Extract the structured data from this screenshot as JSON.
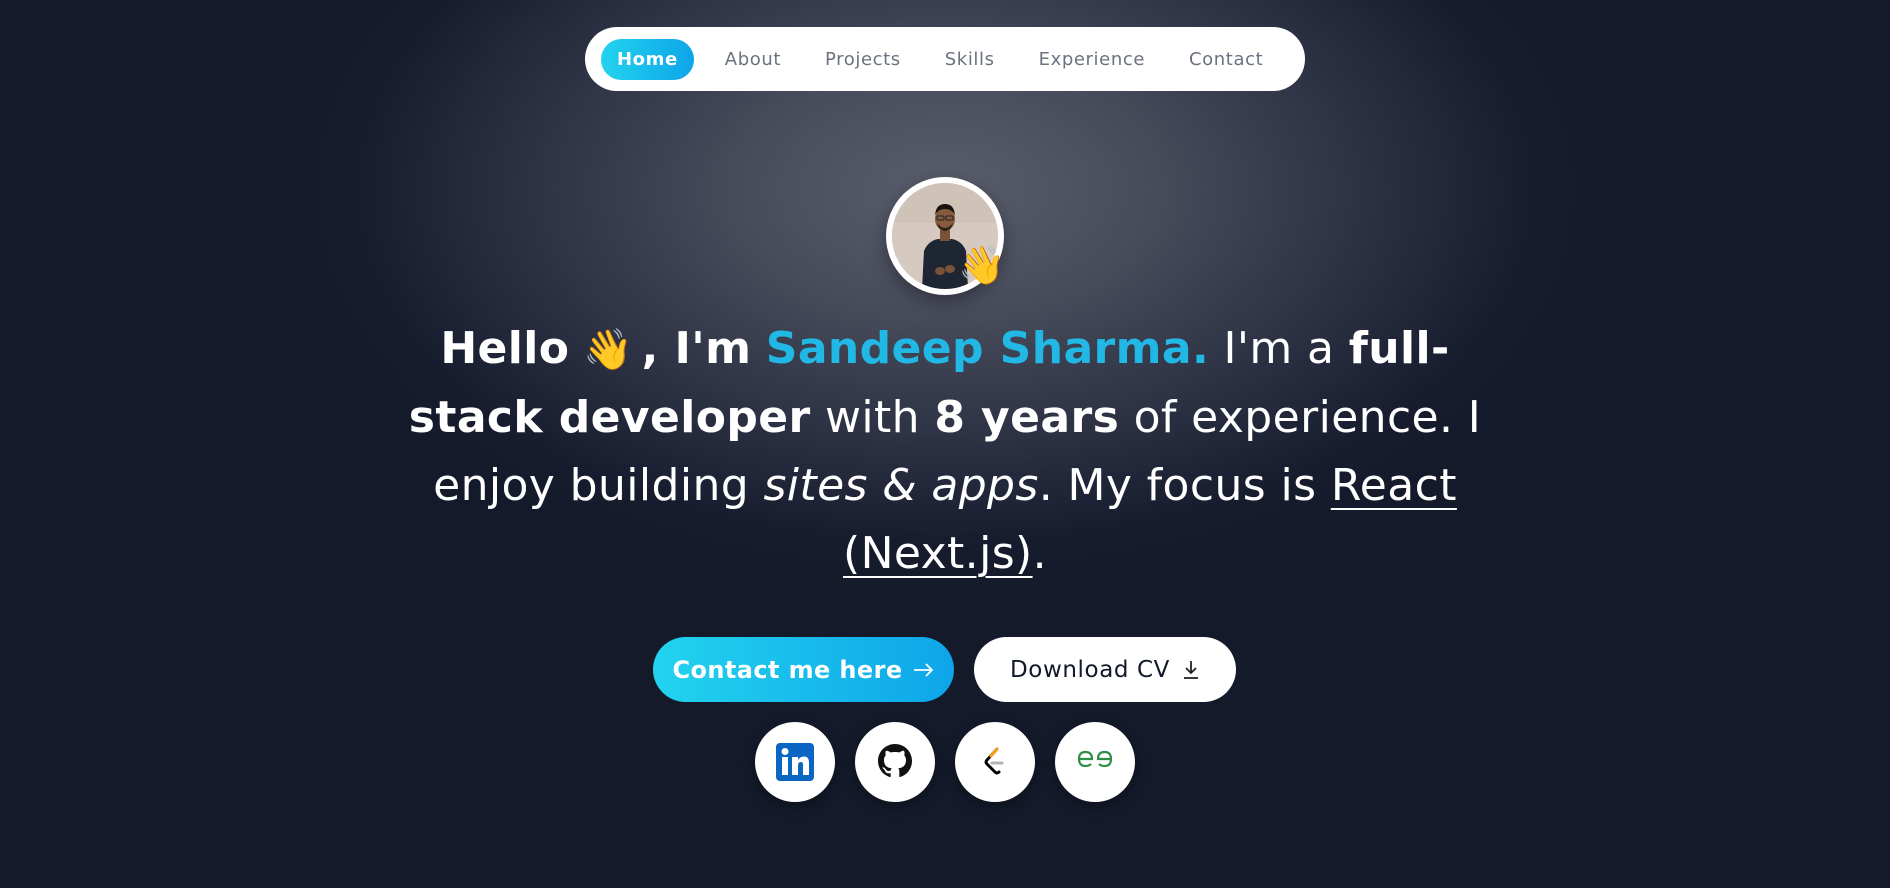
{
  "nav": {
    "items": [
      {
        "label": "Home",
        "active": true
      },
      {
        "label": "About",
        "active": false
      },
      {
        "label": "Projects",
        "active": false
      },
      {
        "label": "Skills",
        "active": false
      },
      {
        "label": "Experience",
        "active": false
      },
      {
        "label": "Contact",
        "active": false
      }
    ]
  },
  "hero": {
    "hello": "Hello",
    "wave": "👋",
    "im": ", I'm",
    "name": "Sandeep Sharma.",
    "im_a": "I'm a",
    "role": "full-stack developer",
    "with": "with",
    "years": "8 years",
    "of_exp": "of experience. I enjoy building",
    "sites_apps": "sites & apps",
    "focus": ". My focus is",
    "tech": "React (Next.js)",
    "end": "."
  },
  "cta": {
    "contact_label": "Contact me here",
    "download_label": "Download CV"
  },
  "social": {
    "linkedin_color": "#0a66c2",
    "github_color": "#111111",
    "leetcode_colors": [
      "#f89f1b",
      "#000000",
      "#b3b3b3"
    ],
    "gfg_color": "#2f8d46",
    "gfg_text": "GG"
  },
  "colors": {
    "accent": "#22d3ee",
    "accent_end": "#0ea5e9",
    "name": "#22b8e6",
    "background": "#161c2d"
  }
}
